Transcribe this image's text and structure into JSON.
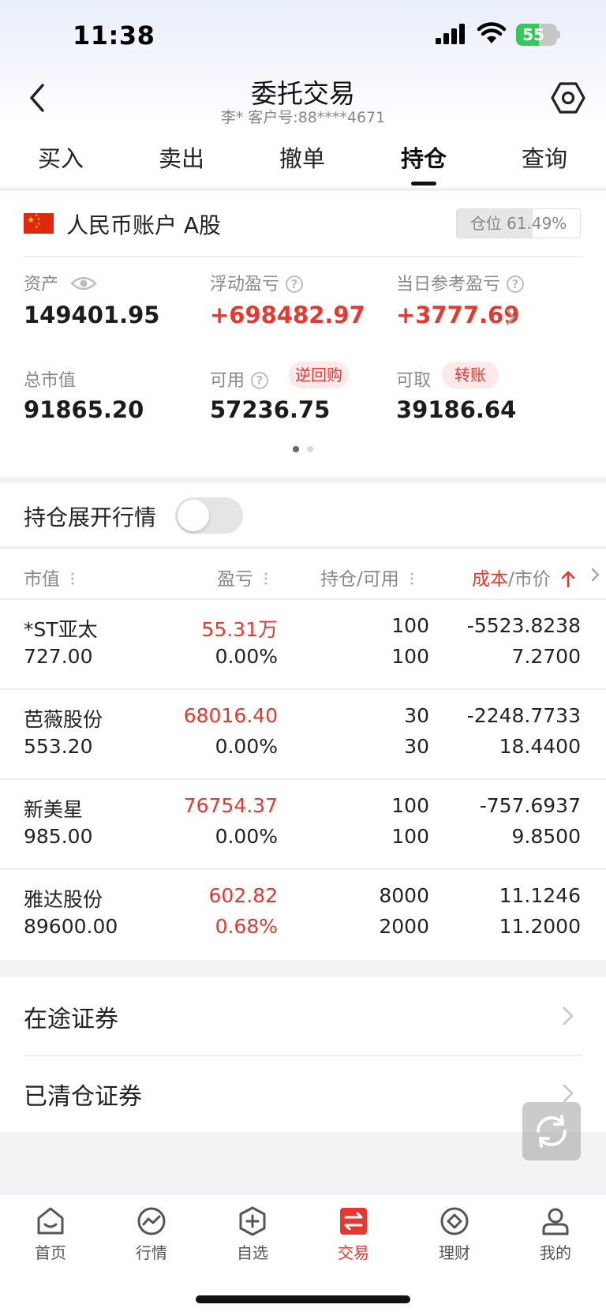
{
  "status_bar": {
    "time": "11:38",
    "battery": "55",
    "battery_level": 0.55
  },
  "header": {
    "title": "委托交易",
    "subtitle": "李*  客户号:88****4671"
  },
  "tabs": [
    {
      "label": "买入"
    },
    {
      "label": "卖出"
    },
    {
      "label": "撤单"
    },
    {
      "label": "持仓",
      "active": true
    },
    {
      "label": "查询"
    }
  ],
  "account": {
    "name": "人民币账户 A股",
    "position_label": "仓位 61.49%",
    "position_ratio": 0.6149,
    "metrics": {
      "assets_label": "资产",
      "assets_value": "149401.95",
      "floating_label": "浮动盈亏",
      "floating_value": "+698482.97",
      "daily_label": "当日参考盈亏",
      "daily_value": "+3777.69",
      "market_label": "总市值",
      "market_value": "91865.20",
      "available_label": "可用",
      "available_tag": "逆回购",
      "available_value": "57236.75",
      "withdraw_label": "可取",
      "withdraw_tag": "转账",
      "withdraw_value": "39186.64"
    },
    "page_dots": 2,
    "active_dot": 0
  },
  "expand_toggle": {
    "label": "持仓展开行情",
    "on": false
  },
  "holdings": {
    "headers": {
      "market_value": "市值",
      "pnl": "盈亏",
      "position": "持仓/可用",
      "cost_red": "成本",
      "cost_rest": "/市价"
    },
    "rows": [
      {
        "name": "*ST亚太",
        "market_value": "727.00",
        "pnl": "55.31万",
        "pnl_pct": "0.00%",
        "position": "100",
        "available": "100",
        "cost": "-5523.8238",
        "price": "7.2700"
      },
      {
        "name": "芭薇股份",
        "market_value": "553.20",
        "pnl": "68016.40",
        "pnl_pct": "0.00%",
        "position": "30",
        "available": "30",
        "cost": "-2248.7733",
        "price": "18.4400"
      },
      {
        "name": "新美星",
        "market_value": "985.00",
        "pnl": "76754.37",
        "pnl_pct": "0.00%",
        "position": "100",
        "available": "100",
        "cost": "-757.6937",
        "price": "9.8500"
      },
      {
        "name": "雅达股份",
        "market_value": "89600.00",
        "pnl": "602.82",
        "pnl_pct": "0.68%",
        "position": "8000",
        "available": "2000",
        "cost": "11.1246",
        "price": "11.2000",
        "pct_red": true
      }
    ]
  },
  "links": [
    {
      "label": "在途证券"
    },
    {
      "label": "已清仓证券"
    }
  ],
  "bottom_nav": [
    {
      "label": "首页",
      "icon": "home-icon"
    },
    {
      "label": "行情",
      "icon": "market-icon"
    },
    {
      "label": "自选",
      "icon": "watchlist-icon"
    },
    {
      "label": "交易",
      "icon": "trade-icon",
      "active": true
    },
    {
      "label": "理财",
      "icon": "wealth-icon"
    },
    {
      "label": "我的",
      "icon": "profile-icon"
    }
  ],
  "colors": {
    "red": "#e8372f",
    "text": "#1f1f1f",
    "muted": "#888888"
  }
}
